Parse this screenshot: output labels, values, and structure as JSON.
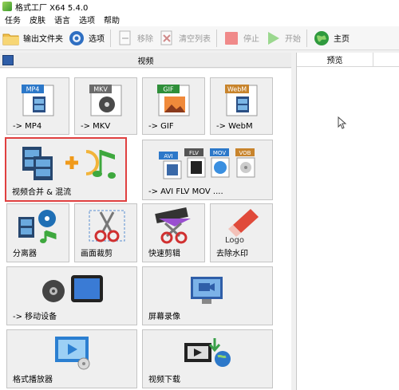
{
  "window": {
    "title": "格式工厂 X64 5.4.0"
  },
  "menu": [
    "任务",
    "皮肤",
    "语言",
    "选项",
    "帮助"
  ],
  "toolbar": {
    "output_folder": "输出文件夹",
    "options": "选项",
    "remove": "移除",
    "clear_list": "清空列表",
    "stop": "停止",
    "start": "开始",
    "home": "主页"
  },
  "left_panel": {
    "title": "视频"
  },
  "tiles": {
    "mp4": "-> MP4",
    "mkv": "-> MKV",
    "gif": "-> GIF",
    "webm": "-> WebM",
    "merge": "视频合并 & 混流",
    "multi": "-> AVI FLV MOV ....",
    "splitter": "分离器",
    "crop": "画面裁剪",
    "quickclip": "快速剪辑",
    "watermark": "去除水印",
    "mobile": "-> 移动设备",
    "screenrec": "屏幕录像",
    "player": "格式播放器",
    "download": "视频下载"
  },
  "badges": {
    "mp4": "MP4",
    "mkv": "MKV",
    "gif": "GIF",
    "webm": "WebM",
    "avi": "AVI",
    "flv": "FLV",
    "mov": "MOV",
    "vob": "VOB",
    "logo": "Logo"
  },
  "right_panel": {
    "column": "预览"
  },
  "colors": {
    "selected_border": "#e04040",
    "tile_bg": "#efefef"
  }
}
